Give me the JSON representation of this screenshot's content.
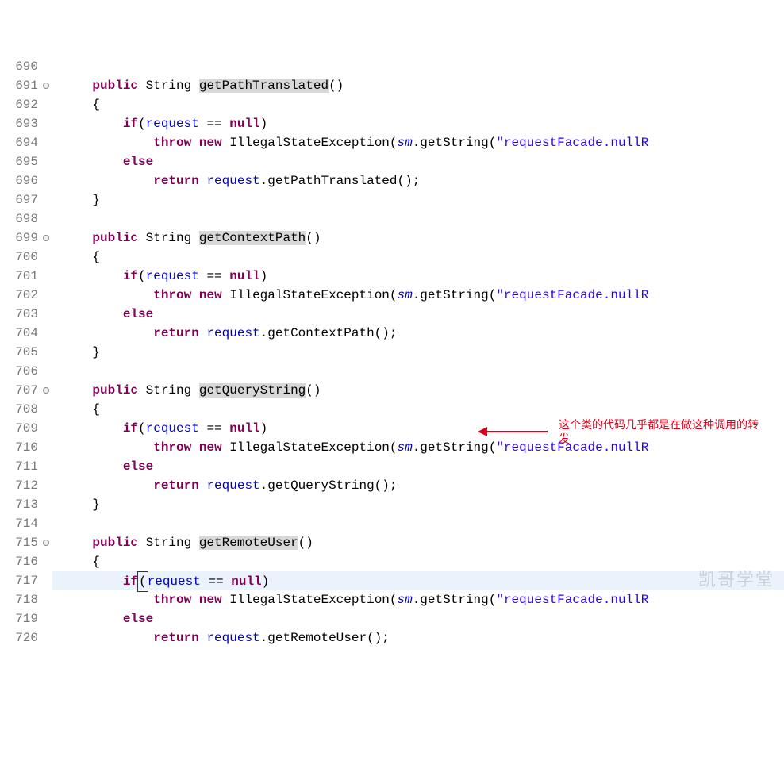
{
  "lines": [
    {
      "num": "690",
      "marker": "",
      "hl": false,
      "tokens": []
    },
    {
      "num": "691",
      "marker": "both",
      "hl": false,
      "tokens": [
        {
          "t": "    "
        },
        {
          "t": "public",
          "c": "kw"
        },
        {
          "t": " "
        },
        {
          "t": "String "
        },
        {
          "t": "getPathTranslated",
          "c": "mthd"
        },
        {
          "t": "()"
        }
      ]
    },
    {
      "num": "692",
      "marker": "",
      "hl": false,
      "tokens": [
        {
          "t": "    {"
        }
      ]
    },
    {
      "num": "693",
      "marker": "",
      "hl": false,
      "tokens": [
        {
          "t": "        "
        },
        {
          "t": "if",
          "c": "kw"
        },
        {
          "t": "("
        },
        {
          "t": "request",
          "c": "fld"
        },
        {
          "t": " == "
        },
        {
          "t": "null",
          "c": "kw"
        },
        {
          "t": ")"
        }
      ]
    },
    {
      "num": "694",
      "marker": "",
      "hl": false,
      "tokens": [
        {
          "t": "            "
        },
        {
          "t": "throw",
          "c": "kw"
        },
        {
          "t": " "
        },
        {
          "t": "new",
          "c": "kw"
        },
        {
          "t": " IllegalStateException("
        },
        {
          "t": "sm",
          "c": "fldi"
        },
        {
          "t": ".getString("
        },
        {
          "t": "\"requestFacade.nullR",
          "c": "str"
        }
      ]
    },
    {
      "num": "695",
      "marker": "",
      "hl": false,
      "tokens": [
        {
          "t": "        "
        },
        {
          "t": "else",
          "c": "kw"
        }
      ]
    },
    {
      "num": "696",
      "marker": "",
      "hl": false,
      "tokens": [
        {
          "t": "            "
        },
        {
          "t": "return",
          "c": "ret"
        },
        {
          "t": " "
        },
        {
          "t": "request",
          "c": "fld"
        },
        {
          "t": ".getPathTranslated();"
        }
      ]
    },
    {
      "num": "697",
      "marker": "",
      "hl": false,
      "tokens": [
        {
          "t": "    }"
        }
      ]
    },
    {
      "num": "698",
      "marker": "",
      "hl": false,
      "tokens": []
    },
    {
      "num": "699",
      "marker": "both",
      "hl": false,
      "tokens": [
        {
          "t": "    "
        },
        {
          "t": "public",
          "c": "kw"
        },
        {
          "t": " "
        },
        {
          "t": "String "
        },
        {
          "t": "getContextPath",
          "c": "mthd"
        },
        {
          "t": "()"
        }
      ]
    },
    {
      "num": "700",
      "marker": "",
      "hl": false,
      "tokens": [
        {
          "t": "    {"
        }
      ]
    },
    {
      "num": "701",
      "marker": "",
      "hl": false,
      "tokens": [
        {
          "t": "        "
        },
        {
          "t": "if",
          "c": "kw"
        },
        {
          "t": "("
        },
        {
          "t": "request",
          "c": "fld"
        },
        {
          "t": " == "
        },
        {
          "t": "null",
          "c": "kw"
        },
        {
          "t": ")"
        }
      ]
    },
    {
      "num": "702",
      "marker": "",
      "hl": false,
      "tokens": [
        {
          "t": "            "
        },
        {
          "t": "throw",
          "c": "kw"
        },
        {
          "t": " "
        },
        {
          "t": "new",
          "c": "kw"
        },
        {
          "t": " IllegalStateException("
        },
        {
          "t": "sm",
          "c": "fldi"
        },
        {
          "t": ".getString("
        },
        {
          "t": "\"requestFacade.nullR",
          "c": "str"
        }
      ]
    },
    {
      "num": "703",
      "marker": "",
      "hl": false,
      "tokens": [
        {
          "t": "        "
        },
        {
          "t": "else",
          "c": "kw"
        }
      ]
    },
    {
      "num": "704",
      "marker": "",
      "hl": false,
      "tokens": [
        {
          "t": "            "
        },
        {
          "t": "return",
          "c": "ret"
        },
        {
          "t": " "
        },
        {
          "t": "request",
          "c": "fld"
        },
        {
          "t": ".getContextPath();"
        }
      ]
    },
    {
      "num": "705",
      "marker": "",
      "hl": false,
      "tokens": [
        {
          "t": "    }"
        }
      ]
    },
    {
      "num": "706",
      "marker": "",
      "hl": false,
      "tokens": []
    },
    {
      "num": "707",
      "marker": "both",
      "hl": false,
      "tokens": [
        {
          "t": "    "
        },
        {
          "t": "public",
          "c": "kw"
        },
        {
          "t": " "
        },
        {
          "t": "String "
        },
        {
          "t": "getQueryString",
          "c": "mthd"
        },
        {
          "t": "()"
        }
      ]
    },
    {
      "num": "708",
      "marker": "",
      "hl": false,
      "tokens": [
        {
          "t": "    {"
        }
      ]
    },
    {
      "num": "709",
      "marker": "",
      "hl": false,
      "tokens": [
        {
          "t": "        "
        },
        {
          "t": "if",
          "c": "kw"
        },
        {
          "t": "("
        },
        {
          "t": "request",
          "c": "fld"
        },
        {
          "t": " == "
        },
        {
          "t": "null",
          "c": "kw"
        },
        {
          "t": ")"
        }
      ]
    },
    {
      "num": "710",
      "marker": "",
      "hl": false,
      "tokens": [
        {
          "t": "            "
        },
        {
          "t": "throw",
          "c": "kw"
        },
        {
          "t": " "
        },
        {
          "t": "new",
          "c": "kw"
        },
        {
          "t": " IllegalStateException("
        },
        {
          "t": "sm",
          "c": "fldi"
        },
        {
          "t": ".getString("
        },
        {
          "t": "\"requestFacade.nullR",
          "c": "str"
        }
      ]
    },
    {
      "num": "711",
      "marker": "",
      "hl": false,
      "tokens": [
        {
          "t": "        "
        },
        {
          "t": "else",
          "c": "kw"
        }
      ]
    },
    {
      "num": "712",
      "marker": "",
      "hl": false,
      "tokens": [
        {
          "t": "            "
        },
        {
          "t": "return",
          "c": "ret"
        },
        {
          "t": " "
        },
        {
          "t": "request",
          "c": "fld"
        },
        {
          "t": ".getQueryString();"
        }
      ]
    },
    {
      "num": "713",
      "marker": "",
      "hl": false,
      "tokens": [
        {
          "t": "    }"
        }
      ]
    },
    {
      "num": "714",
      "marker": "",
      "hl": false,
      "tokens": []
    },
    {
      "num": "715",
      "marker": "both",
      "hl": false,
      "tokens": [
        {
          "t": "    "
        },
        {
          "t": "public",
          "c": "kw"
        },
        {
          "t": " "
        },
        {
          "t": "String "
        },
        {
          "t": "getRemoteUser",
          "c": "mthd"
        },
        {
          "t": "()"
        }
      ]
    },
    {
      "num": "716",
      "marker": "",
      "hl": false,
      "tokens": [
        {
          "t": "    {"
        }
      ]
    },
    {
      "num": "717",
      "marker": "",
      "hl": true,
      "tokens": [
        {
          "t": "        "
        },
        {
          "t": "if",
          "c": "kw"
        },
        {
          "t": "(",
          "cursor": true
        },
        {
          "t": "request",
          "c": "fld"
        },
        {
          "t": " == "
        },
        {
          "t": "null",
          "c": "kw"
        },
        {
          "t": ")"
        }
      ]
    },
    {
      "num": "718",
      "marker": "",
      "hl": false,
      "tokens": [
        {
          "t": "            "
        },
        {
          "t": "throw",
          "c": "kw"
        },
        {
          "t": " "
        },
        {
          "t": "new",
          "c": "kw"
        },
        {
          "t": " IllegalStateException("
        },
        {
          "t": "sm",
          "c": "fldi"
        },
        {
          "t": ".getString("
        },
        {
          "t": "\"requestFacade.nullR",
          "c": "str"
        }
      ]
    },
    {
      "num": "719",
      "marker": "",
      "hl": false,
      "tokens": [
        {
          "t": "        "
        },
        {
          "t": "else",
          "c": "kw"
        }
      ]
    },
    {
      "num": "720",
      "marker": "",
      "hl": false,
      "tokens": [
        {
          "t": "            "
        },
        {
          "t": "return",
          "c": "ret"
        },
        {
          "t": " "
        },
        {
          "t": "request",
          "c": "fld"
        },
        {
          "t": ".getRemoteUser();"
        }
      ]
    }
  ],
  "annotation": "这个类的代码几乎都是在做这种调用的转发",
  "watermark": "凯哥学堂"
}
